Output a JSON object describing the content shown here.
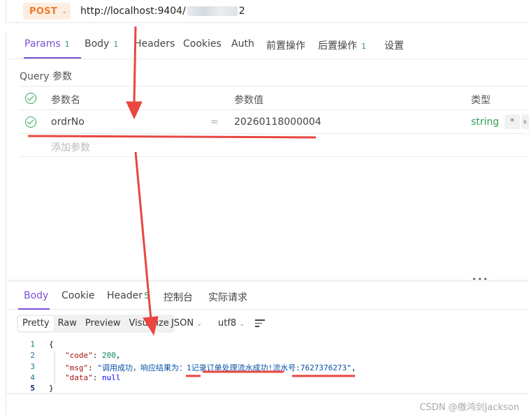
{
  "request": {
    "method": "POST",
    "url_prefix": "http://localhost:9404/",
    "url_suffix": "2"
  },
  "request_tabs": [
    {
      "label": "Params",
      "badge": "1"
    },
    {
      "label": "Body",
      "badge": "1"
    },
    {
      "label": "Headers",
      "badge": ""
    },
    {
      "label": "Cookies",
      "badge": ""
    },
    {
      "label": "Auth",
      "badge": ""
    },
    {
      "label": "前置操作",
      "badge": ""
    },
    {
      "label": "后置操作",
      "badge": "1"
    },
    {
      "label": "设置",
      "badge": ""
    }
  ],
  "query": {
    "title": "Query 参数",
    "headers": {
      "name": "参数名",
      "value": "参数值",
      "type": "类型"
    },
    "rows": [
      {
        "name": "ordrNo",
        "eq": "=",
        "value": "20260118000004",
        "type": "string",
        "required_mark": "*"
      }
    ],
    "add_placeholder": "添加参数"
  },
  "resizer_dots": "•••",
  "response_tabs": [
    {
      "label": "Body",
      "badge": ""
    },
    {
      "label": "Cookie",
      "badge": ""
    },
    {
      "label": "Header",
      "badge": "5"
    },
    {
      "label": "控制台",
      "badge": ""
    },
    {
      "label": "实际请求",
      "badge": ""
    }
  ],
  "view_modes": [
    "Pretty",
    "Raw",
    "Preview",
    "Visualize"
  ],
  "format": "JSON",
  "encoding": "utf8",
  "response_lines": {
    "line_numbers": [
      "1",
      "2",
      "3",
      "4",
      "5"
    ],
    "open_brace": "{",
    "close_brace": "}",
    "code_key": "\"code\"",
    "code_value": "200",
    "msg_key": "\"msg\"",
    "msg_value": "\"调用成功，响应结果为：1记录订单处理流水成功!流水号:7627376273\"",
    "data_key": "\"data\"",
    "data_value": "null"
  },
  "watermark": "CSDN @缴鸿剑Jackson",
  "colors": {
    "accent": "#7a4fd6",
    "method": "#f07c2a",
    "success": "#2f9e58",
    "annotation": "#e8463f"
  }
}
